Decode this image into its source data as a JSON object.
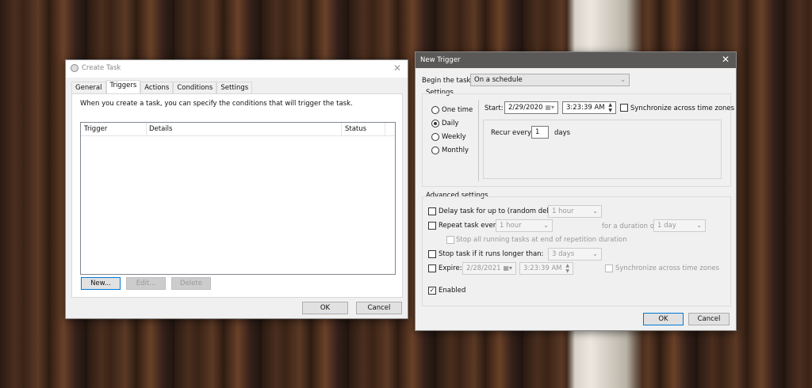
{
  "create_task": {
    "title": "Create Task",
    "tabs": [
      "General",
      "Triggers",
      "Actions",
      "Conditions",
      "Settings"
    ],
    "active_tab": "Triggers",
    "description": "When you create a task, you can specify the conditions that will trigger the task.",
    "columns": [
      "Trigger",
      "Details",
      "Status"
    ],
    "rows": [],
    "new_label": "New...",
    "edit_label": "Edit...",
    "delete_label": "Delete",
    "ok_label": "OK",
    "cancel_label": "Cancel"
  },
  "new_trigger": {
    "title": "New Trigger",
    "begin_label": "Begin the task:",
    "begin_value": "On a schedule",
    "settings_label": "Settings",
    "schedule_options": [
      "One time",
      "Daily",
      "Weekly",
      "Monthly"
    ],
    "selected_schedule": "Daily",
    "start_label": "Start:",
    "start_date": "2/29/2020",
    "start_time": "3:23:39 AM",
    "sync_label": "Synchronize across time zones",
    "sync_checked": false,
    "recur_label": "Recur every:",
    "recur_value": "1",
    "recur_unit": "days",
    "advanced_label": "Advanced settings",
    "delay_label": "Delay task for up to (random delay):",
    "delay_value": "1 hour",
    "repeat_label": "Repeat task every:",
    "repeat_value": "1 hour",
    "duration_label": "for a duration of:",
    "duration_value": "1 day",
    "stop_all_label": "Stop all running tasks at end of repetition duration",
    "stop_label": "Stop task if it runs longer than:",
    "stop_value": "3 days",
    "expire_label": "Expire:",
    "expire_date": "2/28/2021",
    "expire_time": "3:23:39 AM",
    "expire_sync_label": "Synchronize across time zones",
    "enabled_label": "Enabled",
    "enabled_checked": true,
    "ok_label": "OK",
    "cancel_label": "Cancel"
  }
}
